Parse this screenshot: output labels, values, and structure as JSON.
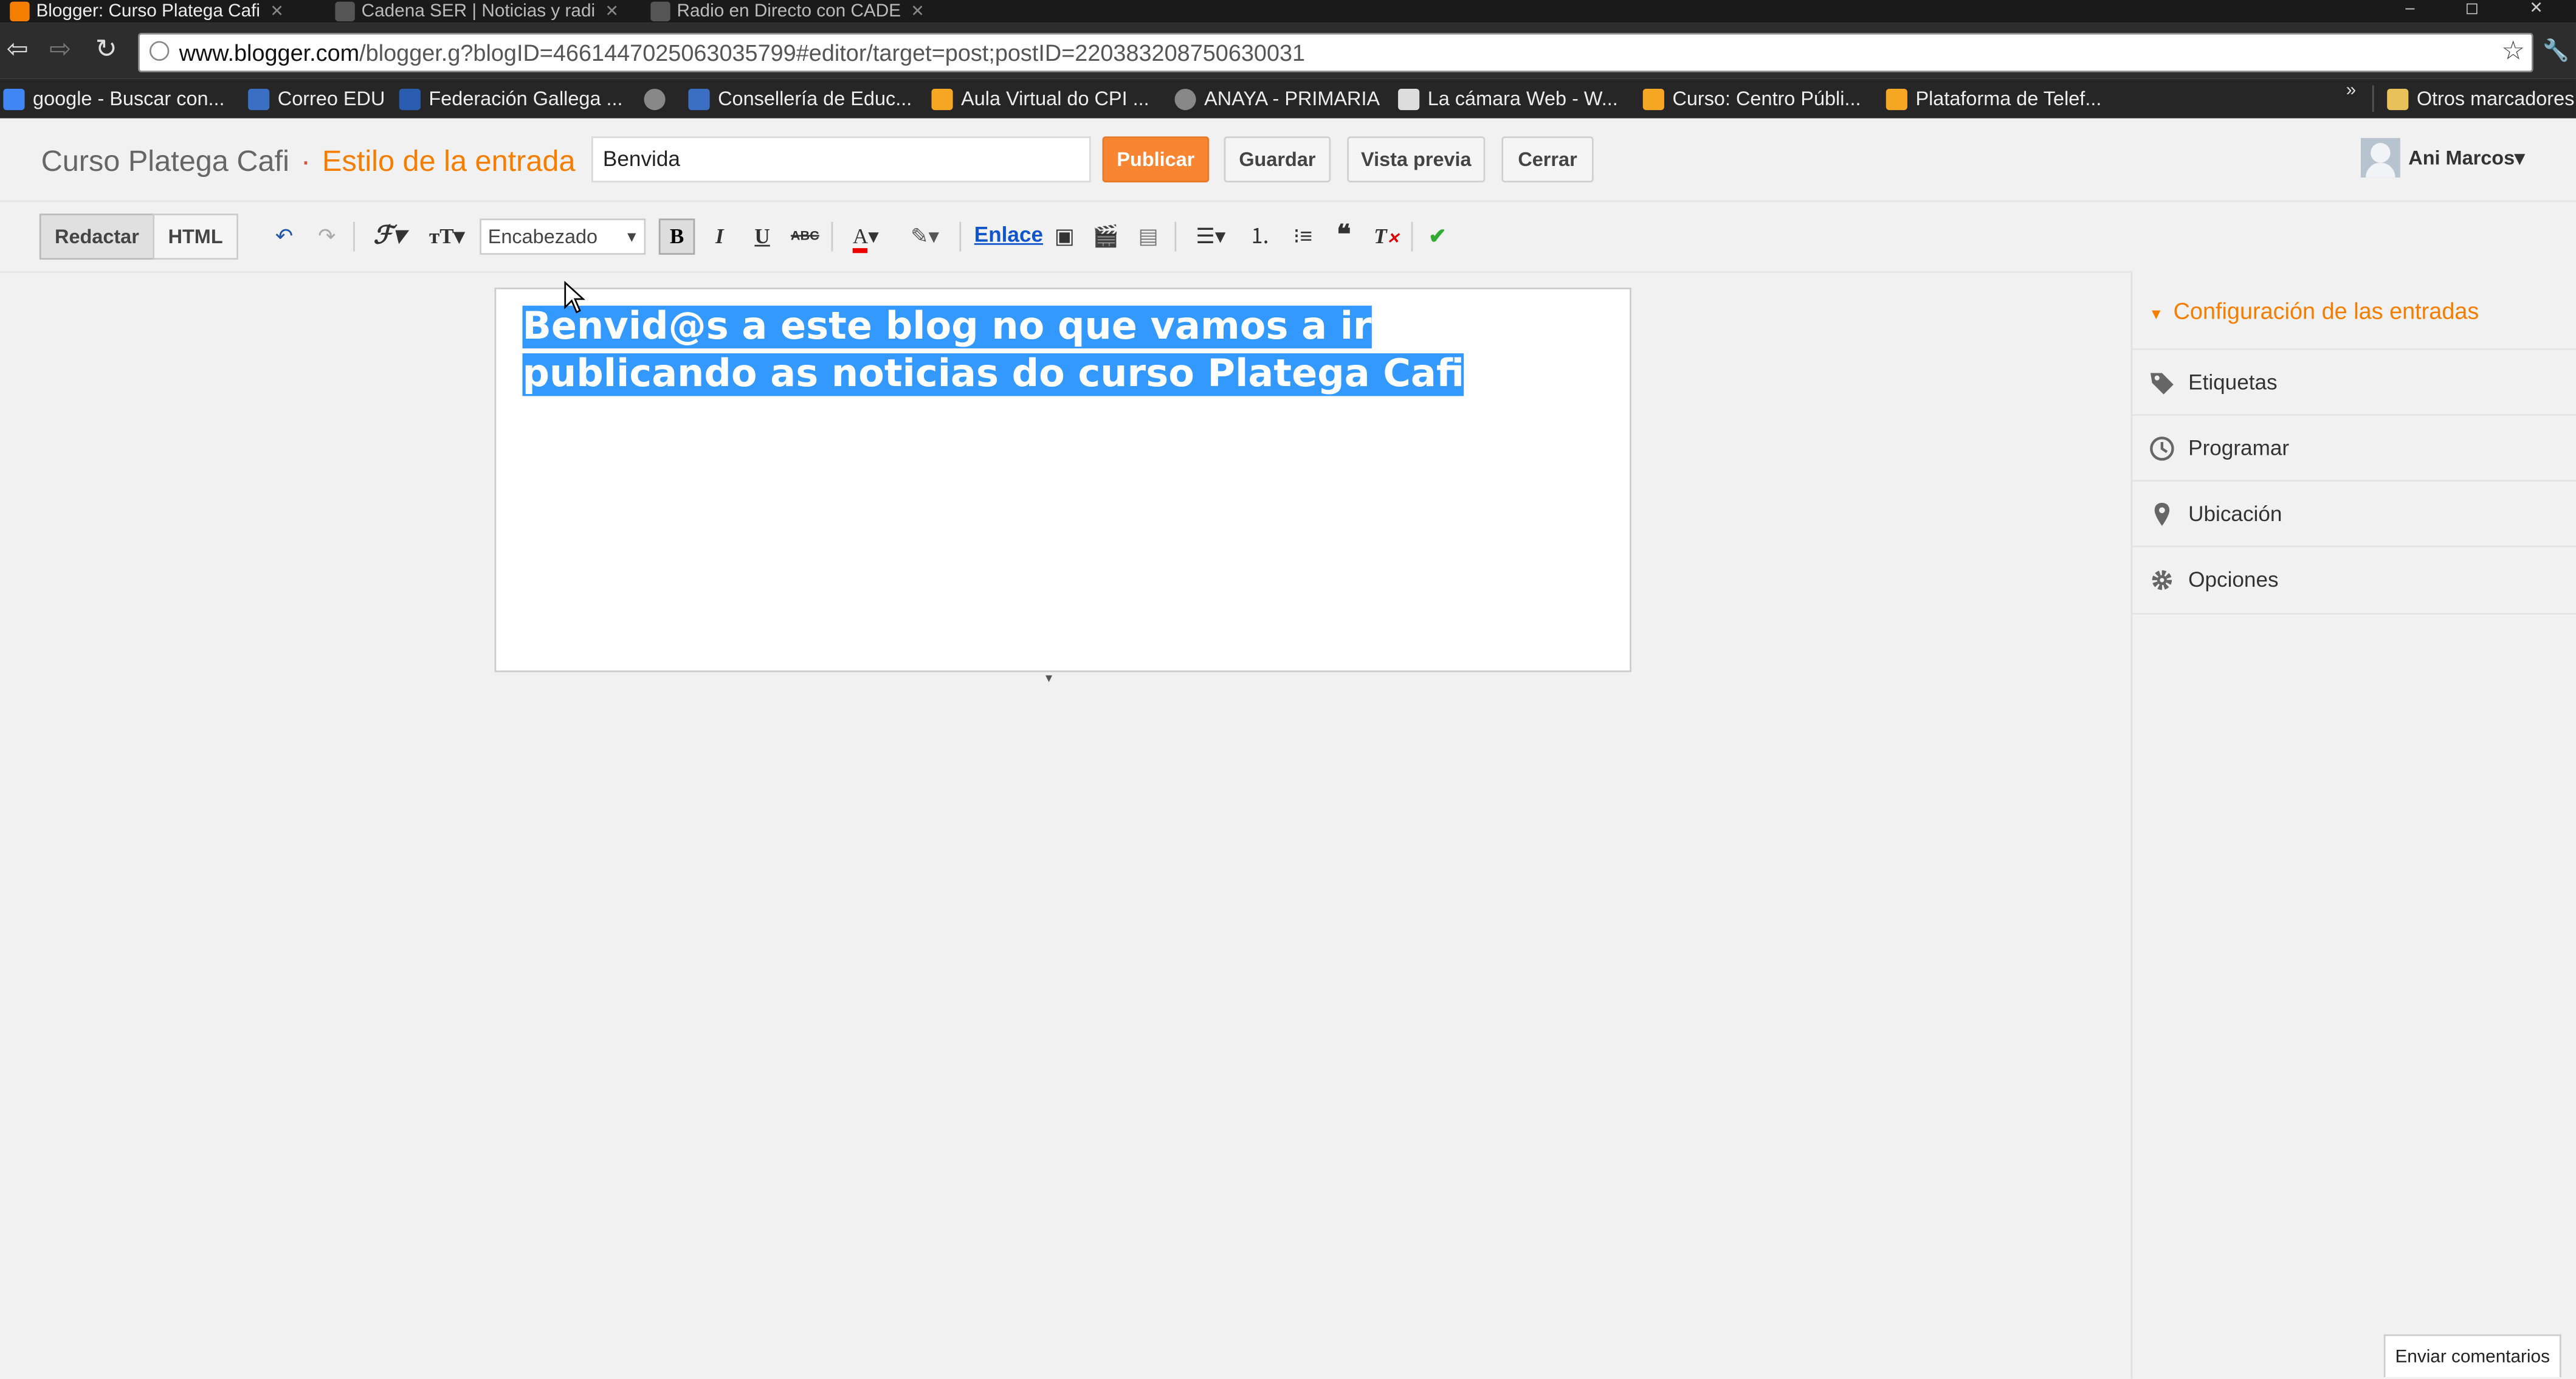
{
  "browser": {
    "tabs": [
      {
        "title": "Blogger: Curso Platega Cafi",
        "active": true
      },
      {
        "title": "Cadena SER | Noticias y radi",
        "active": false
      },
      {
        "title": "Radio en Directo con CADE",
        "active": false
      }
    ],
    "window_controls": "– ◻ ✕",
    "url_host": "www.blogger.com",
    "url_path": "/blogger.g?blogID=4661447025063035799#editor/target=post;postID=220383208750630031",
    "bookmarks": [
      {
        "label": "google - Buscar con...",
        "color": "#4285f4"
      },
      {
        "label": "Correo EDU",
        "color": "#3a6fc4"
      },
      {
        "label": "Federación Gallega ...",
        "color": "#2a5db0"
      },
      {
        "label": "",
        "color": "#888888"
      },
      {
        "label": "Consellería de Educ...",
        "color": "#3a6fc4"
      },
      {
        "label": "Aula Virtual do CPI ...",
        "color": "#f5a623"
      },
      {
        "label": "ANAYA - PRIMARIA",
        "color": "#888888"
      },
      {
        "label": "La cámara Web - W...",
        "color": "#dddddd"
      },
      {
        "label": "Curso: Centro Públi...",
        "color": "#f5a623"
      },
      {
        "label": "Plataforma de Telef...",
        "color": "#f5a623"
      }
    ],
    "chevron": "»",
    "other_bookmarks": "Otros marcadores"
  },
  "header": {
    "blog_name": "Curso Platega Cafi",
    "separator": "·",
    "section": "Estilo de la entrada",
    "post_title_value": "Benvida",
    "publish_label": "Publicar",
    "save_label": "Guardar",
    "preview_label": "Vista previa",
    "close_label": "Cerrar",
    "user_name": "Ani Marcos▾"
  },
  "toolbar": {
    "compose_label": "Redactar",
    "html_label": "HTML",
    "format_value": "Encabezado",
    "link_label": "Enlace"
  },
  "editor": {
    "line1": "Benvid@s a este blog no que vamos a ir",
    "line2": "publicando as noticias do curso Platega Cafi"
  },
  "sidebar": {
    "heading": "Configuración de las entradas",
    "items": [
      {
        "label": "Etiquetas",
        "icon": "tag-icon"
      },
      {
        "label": "Programar",
        "icon": "clock-icon"
      },
      {
        "label": "Ubicación",
        "icon": "location-pin-icon"
      },
      {
        "label": "Opciones",
        "icon": "gear-icon"
      }
    ]
  },
  "feedback_label": "Enviar comentarios",
  "colors": {
    "accent": "#f57d00",
    "publish": "#f88531",
    "selection": "#3399ff",
    "link": "#1155cc"
  }
}
